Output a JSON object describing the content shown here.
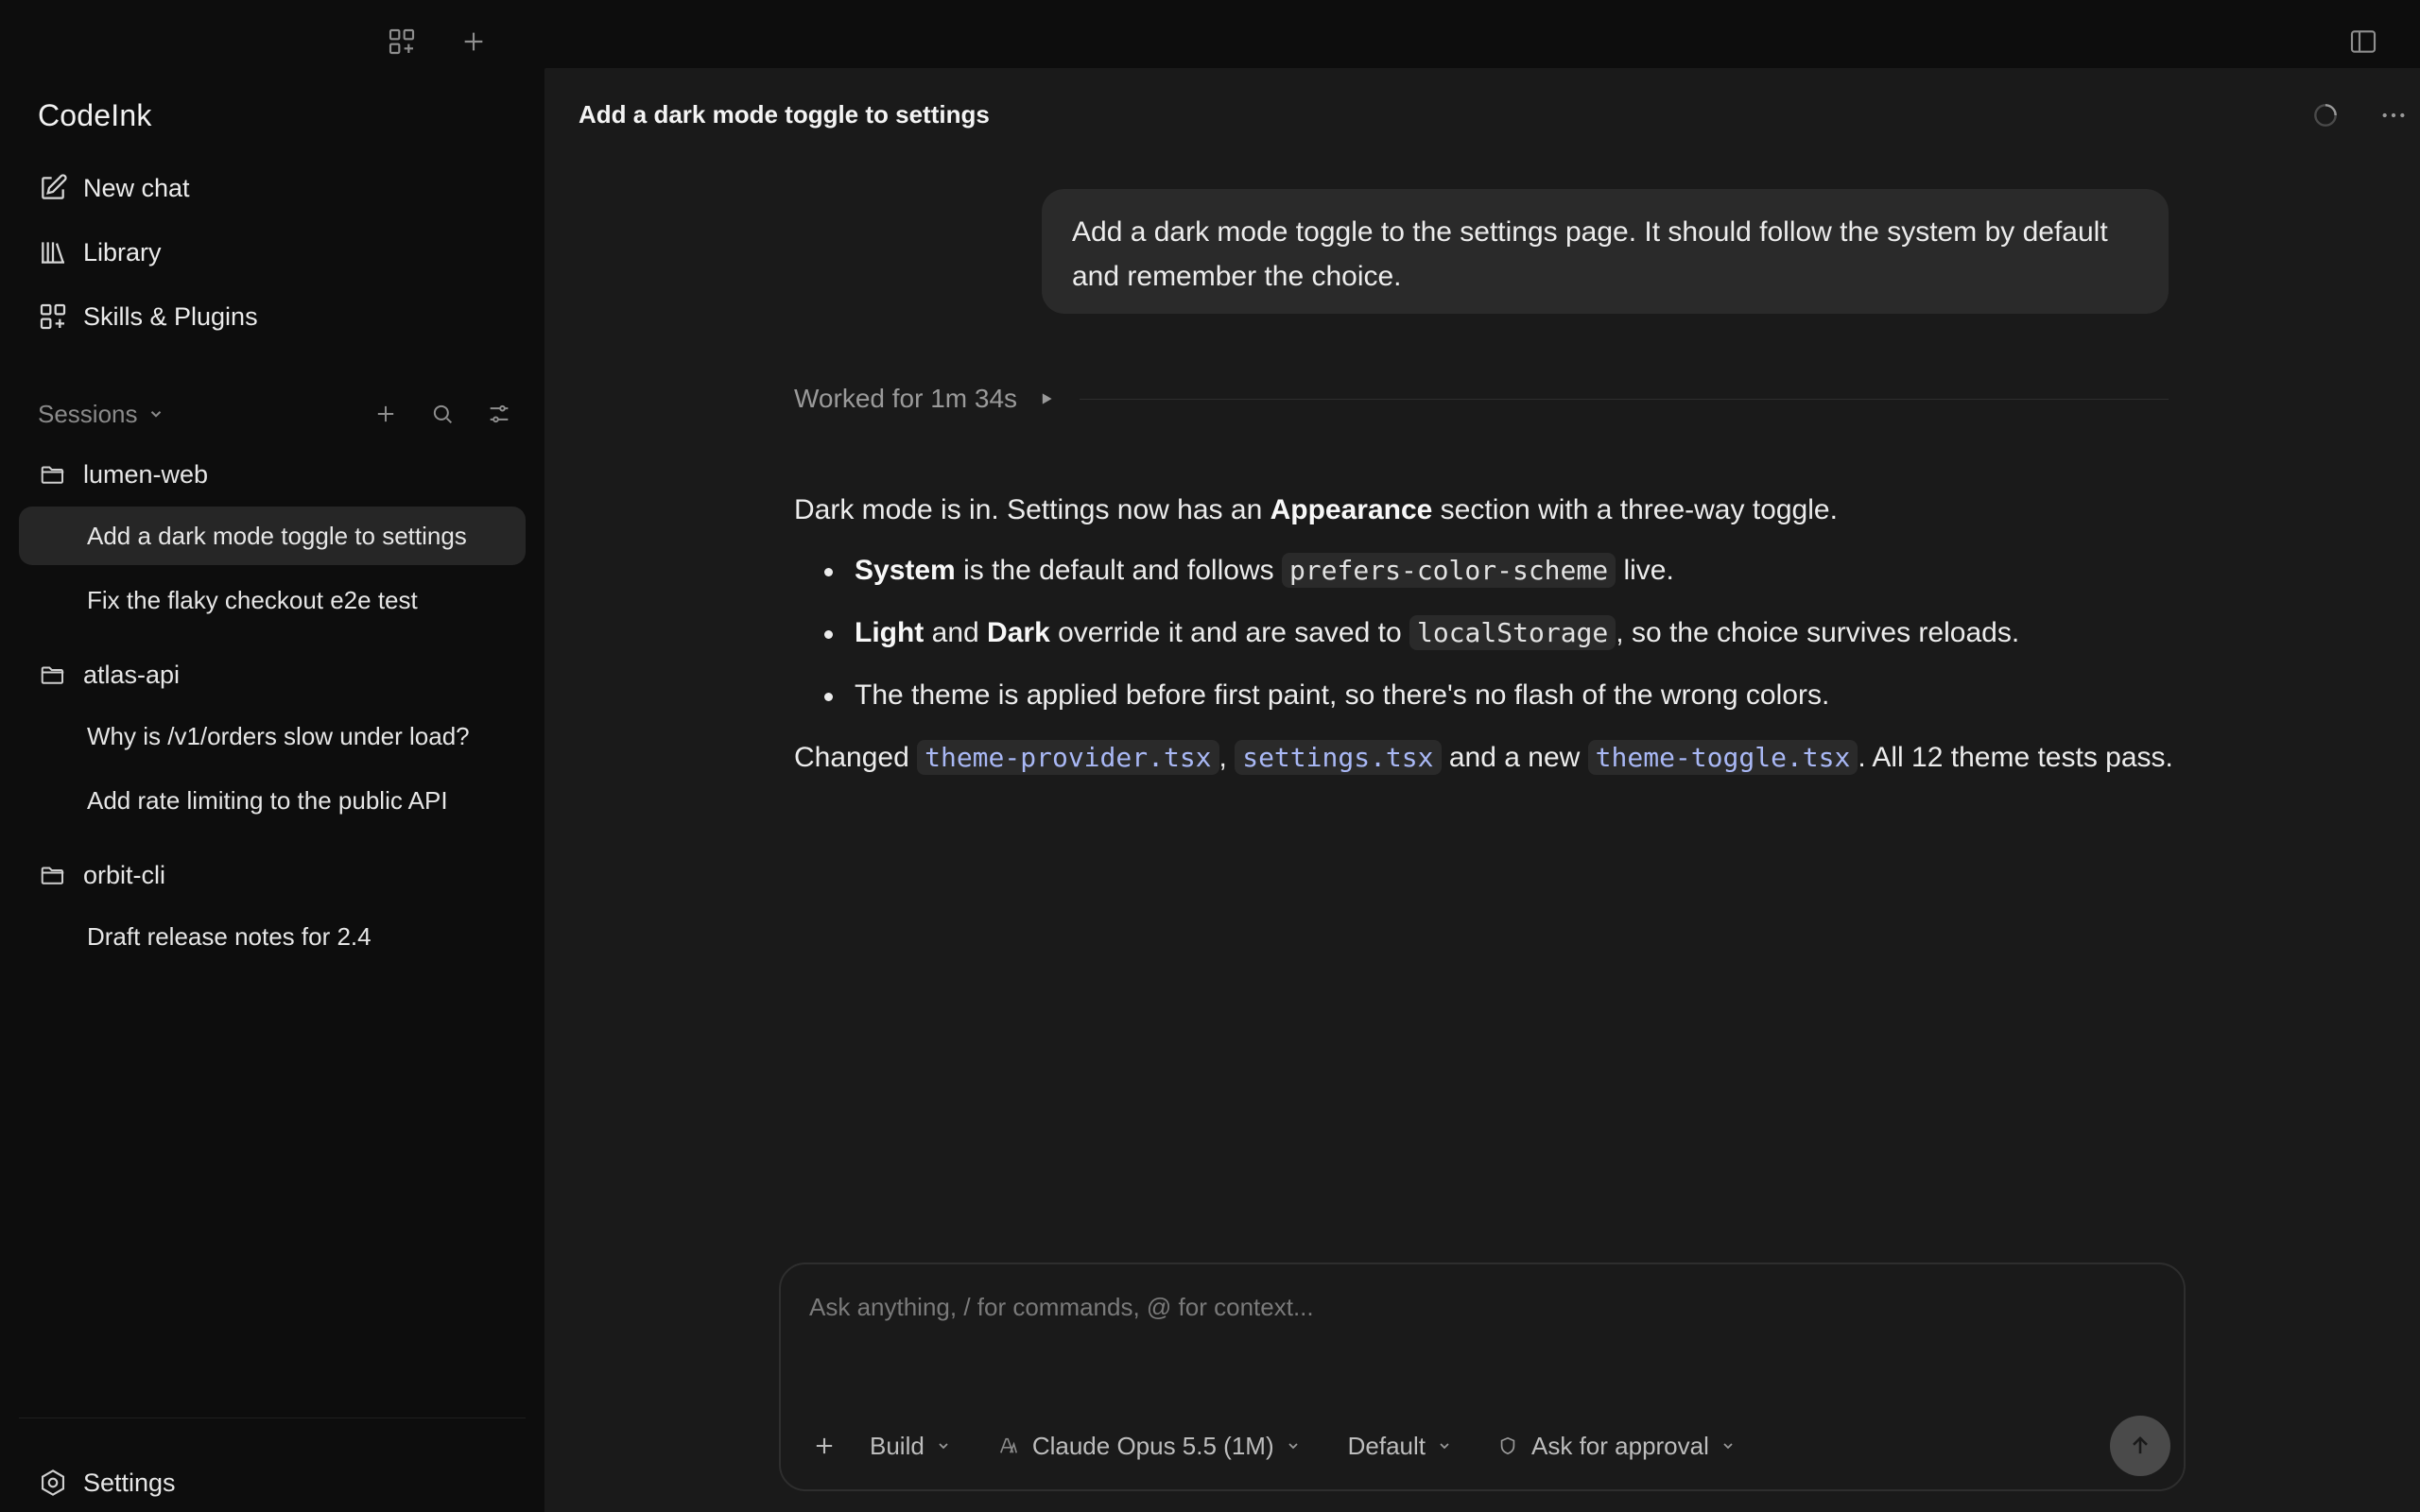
{
  "app": {
    "name": "CodeInk"
  },
  "sidebar": {
    "nav": [
      {
        "label": "New chat",
        "icon": "compose-icon"
      },
      {
        "label": "Library",
        "icon": "library-icon"
      },
      {
        "label": "Skills & Plugins",
        "icon": "grid-plus-icon"
      }
    ],
    "sessions_label": "Sessions",
    "projects": [
      {
        "name": "lumen-web",
        "sessions": [
          "Add a dark mode toggle to settings",
          "Fix the flaky checkout e2e test"
        ]
      },
      {
        "name": "atlas-api",
        "sessions": [
          "Why is /v1/orders slow under load?",
          "Add rate limiting to the public API"
        ]
      },
      {
        "name": "orbit-cli",
        "sessions": [
          "Draft release notes for 2.4"
        ]
      }
    ],
    "active_session": "Add a dark mode toggle to settings",
    "settings_label": "Settings"
  },
  "main": {
    "title": "Add a dark mode toggle to settings",
    "user_message": "Add a dark mode toggle to the settings page. It should follow the system by default and remember the choice.",
    "worked_for": "Worked for 1m 34s",
    "answer": {
      "intro_pre": "Dark mode is in. Settings now has an ",
      "intro_bold": "Appearance",
      "intro_post": " section with a three-way toggle.",
      "b1_bold": "System",
      "b1_mid": " is the default and follows ",
      "b1_code": "prefers-color-scheme",
      "b1_post": " live.",
      "b2_bold1": "Light",
      "b2_and": " and ",
      "b2_bold2": "Dark",
      "b2_mid": " override it and are saved to ",
      "b2_code": "localStorage",
      "b2_post": ", so the choice survives reloads.",
      "b3": "The theme is applied before first paint, so there's no flash of the wrong colors.",
      "changed_pre": "Changed ",
      "file1": "theme-provider.tsx",
      "sep1": ", ",
      "file2": "settings.tsx",
      "sep2": " and a new ",
      "file3": "theme-toggle.tsx",
      "changed_post": ". All 12 theme tests pass."
    }
  },
  "composer": {
    "placeholder": "Ask anything, / for commands, @ for context...",
    "mode": "Build",
    "model": "Claude Opus 5.5 (1M)",
    "preset": "Default",
    "approval": "Ask for approval"
  },
  "colors": {
    "main_bg": "#1a1a1a",
    "sidebar_bg": "#0d0d0d",
    "file_link": "#a9b8f5"
  }
}
